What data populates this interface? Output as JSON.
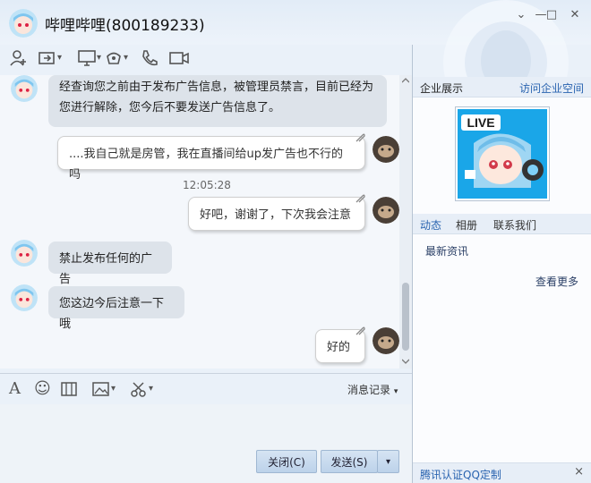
{
  "window": {
    "title": "哔哩哔哩(800189233)",
    "controls": {
      "more": "⌄",
      "minimize": "—",
      "maximize": "□",
      "close": "✕"
    }
  },
  "toolbar": {
    "icons": [
      "add-contact-icon",
      "file-transfer-icon",
      "remote-desktop-icon",
      "app-icon",
      "voice-call-icon",
      "video-call-icon"
    ],
    "dropdown_glyph": "▾"
  },
  "chat": {
    "messages": [
      {
        "from": "them",
        "text": "经查询您之前由于发布广告信息，被管理员禁言，目前已经为您进行解除，您今后不要发送广告信息了。"
      },
      {
        "from": "me",
        "text": "....我自己就是房管，我在直播间给up发广告也不行的吗"
      },
      {
        "time": "12:05:28"
      },
      {
        "from": "me",
        "text": "好吧，谢谢了，下次我会注意"
      },
      {
        "from": "them",
        "text": "禁止发布任何的广告"
      },
      {
        "from": "them",
        "text": "您这边今后注意一下哦"
      },
      {
        "from": "me",
        "text": "好的"
      }
    ],
    "msg1_line1": "经查询您之前由于发布广告信息，被管理员禁言，目前已经为",
    "msg1_line2": "您进行解除，您今后不要发送广告信息了。",
    "msg2": "....我自己就是房管，我在直播间给up发广告也不行的吗",
    "time": "12:05:28",
    "msg3": "好吧，谢谢了，下次我会注意",
    "msg4": "禁止发布任何的广告",
    "msg5": "您这边今后注意一下哦",
    "msg6": "好的"
  },
  "input_toolbar": {
    "font_glyph": "A",
    "emoji_glyph": "☺",
    "record_label": "消息记录",
    "dropdown_glyph": "▾"
  },
  "buttons": {
    "close": "关闭(C)",
    "send": "发送(S)",
    "send_menu": "▾"
  },
  "right_panel": {
    "title": "企业展示",
    "visit_link": "访问企业空间",
    "logo_text": "LIVE",
    "tabs": [
      "动态",
      "相册",
      "联系我们"
    ],
    "news_label": "最新资讯",
    "more_link": "查看更多",
    "footer": "腾讯认证QQ定制",
    "footer_close": "×"
  },
  "colors": {
    "accent": "#2a64b0",
    "bubble_in": "#dde3ea",
    "bubble_out": "#ffffff",
    "logo_bg": "#1aa6e8"
  }
}
